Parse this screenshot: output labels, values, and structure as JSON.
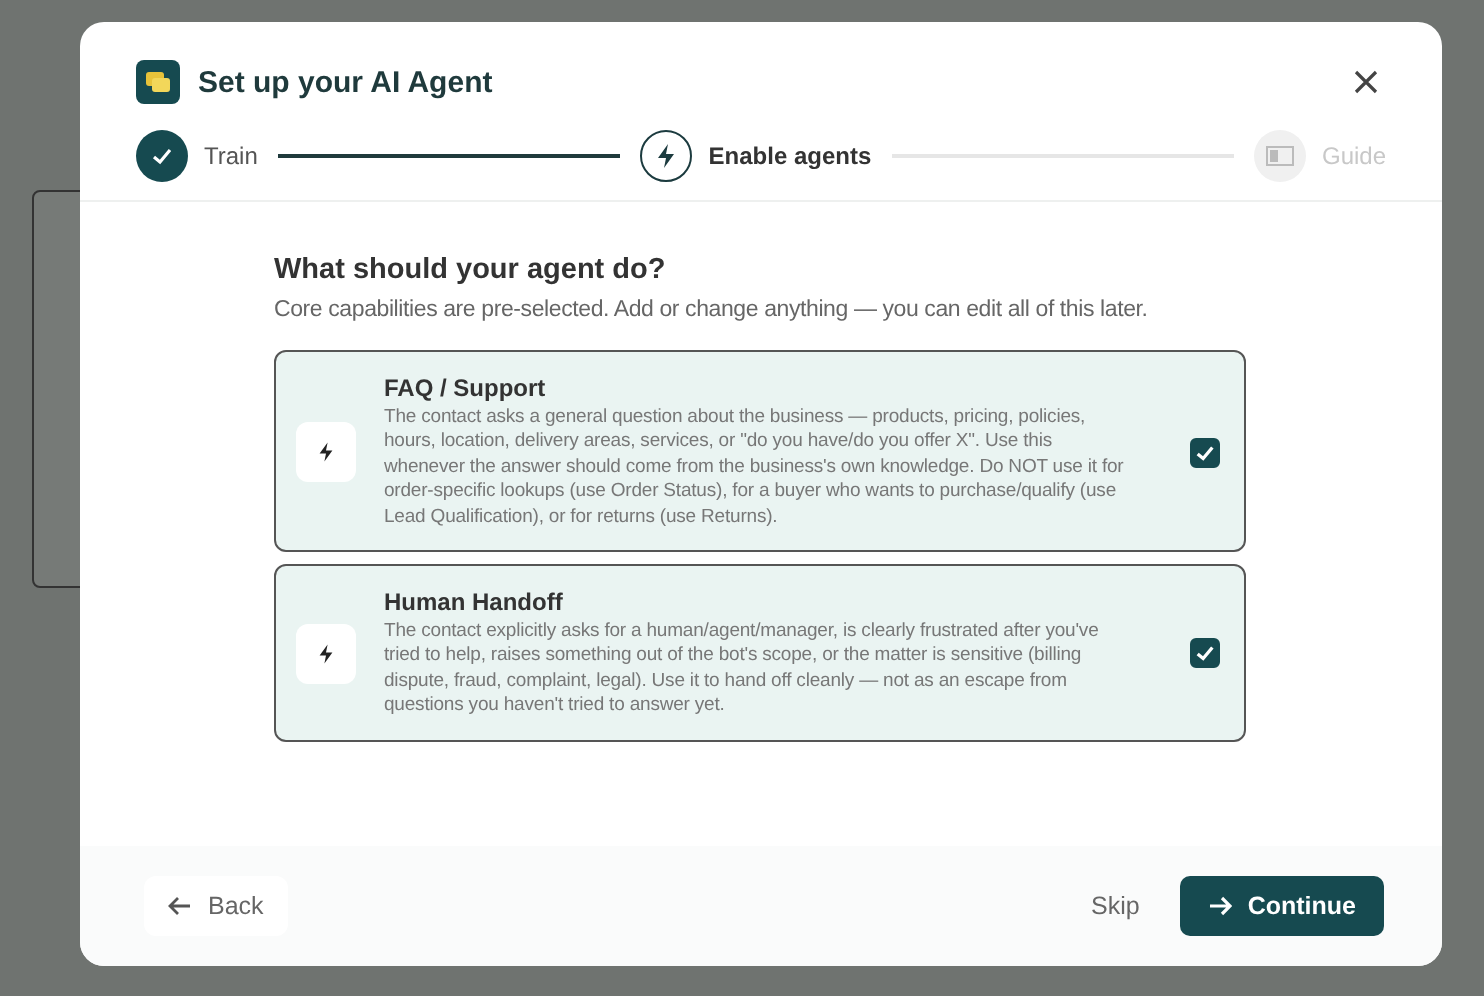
{
  "window": {
    "title": "Set up your AI Agent"
  },
  "steps": [
    {
      "label": "Train",
      "completed": true,
      "selected": false
    },
    {
      "label": "Enable agents",
      "completed": false,
      "selected": true
    },
    {
      "label": "Guide",
      "completed": false,
      "selected": false
    }
  ],
  "heading": "What should your agent do?",
  "subtitle": "Core capabilities are pre-selected. Add or change anything — you can edit all of this later.",
  "capabilities": [
    {
      "title": "FAQ / Support",
      "description": "The contact asks a general question about the business — products, pricing, policies, hours, location, delivery areas, services, or \"do you have/do you offer X\". Use this whenever the answer should come from the business's own knowledge. Do NOT use it for order-specific lookups (use Order Status), for a buyer who wants to purchase/qualify (use Lead Qualification), or for returns (use Returns).",
      "checked": true
    },
    {
      "title": "Human Handoff",
      "description": "The contact explicitly asks for a human/agent/manager, is clearly frustrated after you've tried to help, raises something out of the bot's scope, or the matter is sensitive (billing dispute, fraud, complaint, legal). Use it to hand off cleanly — not as an escape from questions you haven't tried to answer yet.",
      "checked": true
    }
  ],
  "footer": {
    "back": "Back",
    "skip": "Skip",
    "continue": "Continue"
  }
}
